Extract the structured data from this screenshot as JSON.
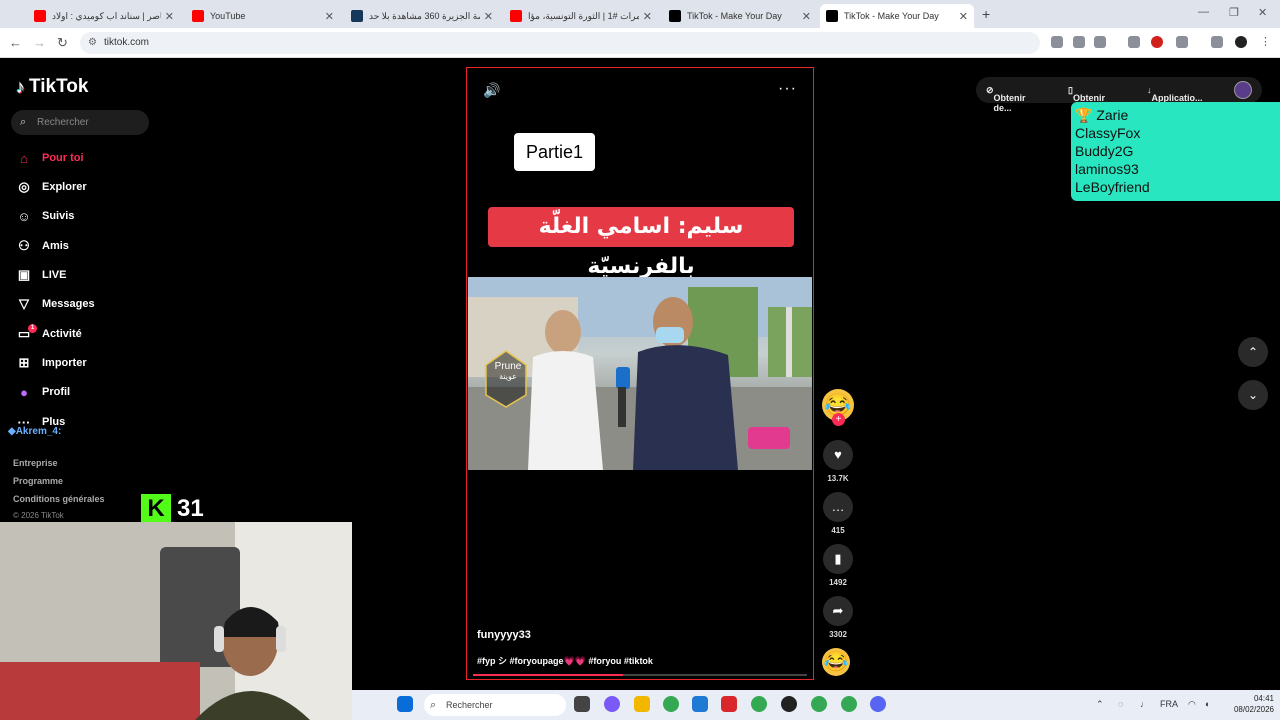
{
  "browser": {
    "tabs": [
      {
        "label": "مينا ناصر | سناند اب كوميدي : اولاد",
        "fav_color": "#ff0000"
      },
      {
        "label": "YouTube",
        "fav_color": "#ff0000"
      },
      {
        "label": "منصة الجزيرة 360 مشاهدة بلا حد",
        "fav_color": "#16365c"
      },
      {
        "label": "مؤامرات #1 | الثورة التونسية، مؤا",
        "fav_color": "#ff0000"
      },
      {
        "label": "TikTok - Make Your Day",
        "fav_color": "#000000"
      },
      {
        "label": "TikTok - Make Your Day",
        "fav_color": "#000000"
      }
    ],
    "new_tab": "+",
    "url": "tiktok.com"
  },
  "sidebar": {
    "logo": "TikTok",
    "search_placeholder": "Rechercher",
    "items": [
      {
        "label": "Pour toi",
        "icon": "home-icon"
      },
      {
        "label": "Explorer",
        "icon": "compass-icon"
      },
      {
        "label": "Suivis",
        "icon": "user-check-icon"
      },
      {
        "label": "Amis",
        "icon": "friends-icon"
      },
      {
        "label": "LIVE",
        "icon": "live-icon"
      },
      {
        "label": "Messages",
        "icon": "send-icon"
      },
      {
        "label": "Activité",
        "icon": "inbox-icon"
      },
      {
        "label": "Importer",
        "icon": "upload-icon"
      },
      {
        "label": "Profil",
        "icon": "profile-icon"
      },
      {
        "label": "Plus",
        "icon": "more-icon"
      }
    ],
    "activity_badge": "1",
    "footer": [
      "Entreprise",
      "Programme",
      "Conditions générales"
    ],
    "copyright": "© 2026 TikTok"
  },
  "overlay": {
    "chat_user": "Akrem_4:",
    "kick_count": "31",
    "leaderboard": [
      "Zarie",
      "ClassyFox",
      "Buddy2G",
      "laminos93",
      "LeBoyfriend"
    ]
  },
  "video": {
    "partie_label": "Partie1",
    "banner_text": "سليم: اسامي الغلّة بالفرنسيّة",
    "watermark_text": "Prune",
    "watermark_sub": "عوينة",
    "author": "funyyyy33",
    "hashtags": "#fyp シ #foryoupage💗💗 #foryou #tiktok",
    "progress": 0.45
  },
  "actions": {
    "likes": "13.7K",
    "comments": "415",
    "saves": "1492",
    "shares": "3302"
  },
  "header_links": [
    "Obtenir de...",
    "Obtenir l'a...",
    "Applicatio..."
  ],
  "taskbar": {
    "search_placeholder": "Rechercher",
    "lang": "FRA",
    "time": "04:41",
    "date": "08/02/2026"
  },
  "colors": {
    "accent": "#fe2c55",
    "leaderboard_bg": "#28e6c0",
    "banner_red": "#e63946",
    "kick_green": "#53fc18"
  }
}
